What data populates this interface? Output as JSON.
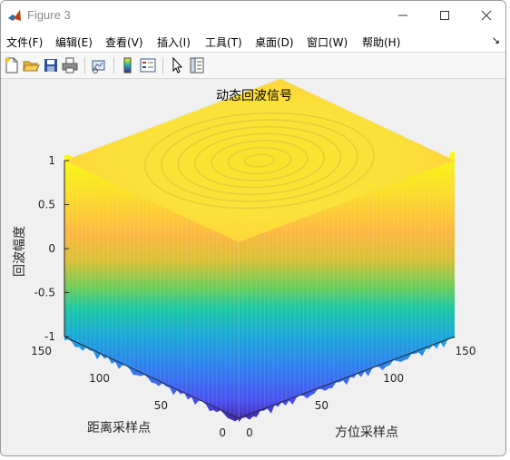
{
  "window": {
    "title": "Figure 3"
  },
  "menu": {
    "items": [
      "文件(F)",
      "编辑(E)",
      "查看(V)",
      "插入(I)",
      "工具(T)",
      "桌面(D)",
      "窗口(W)",
      "帮助(H)"
    ],
    "overflow_icon": "dock-arrow-icon"
  },
  "toolbar": {
    "buttons": [
      "new-figure-icon",
      "open-file-icon",
      "save-icon",
      "print-icon",
      "link-plot-icon",
      "colorbar-icon",
      "legend-icon",
      "select-pointer-icon",
      "property-editor-icon"
    ]
  },
  "chart_data": {
    "type": "surface",
    "title": "动态回波信号",
    "xlabel": "方位采样点",
    "ylabel": "距离采样点",
    "zlabel": "回波幅度",
    "x_ticks": [
      "0",
      "50",
      "100",
      "150"
    ],
    "y_ticks": [
      "0",
      "50",
      "100",
      "150"
    ],
    "z_ticks": [
      "-1",
      "-0.5",
      "0",
      "0.5",
      "1"
    ],
    "xlim": [
      0,
      150
    ],
    "ylim": [
      0,
      150
    ],
    "zlim": [
      -1,
      1
    ],
    "colormap": "parula",
    "grid": true
  }
}
